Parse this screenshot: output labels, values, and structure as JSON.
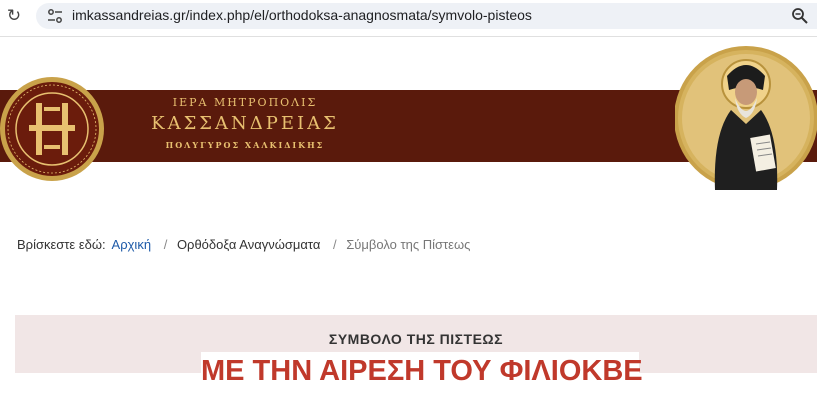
{
  "browser": {
    "url": "imkassandreias.gr/index.php/el/orthodoksa-anagnosmata/symvolo-pisteos",
    "reload_icon": "reload-icon",
    "site_info_icon": "tune-icon",
    "zoom_icon": "zoom-icon"
  },
  "header": {
    "line1": "ΙΕΡΑ ΜΗΤΡΟΠΟΛΙΣ",
    "line2": "ΚΑΣΣΑΝΔΡΕΙΑΣ",
    "line3": "ΠΟΛΥΓΥΡΟΣ ΧΑΛΚΙΔΙΚΗΣ",
    "colors": {
      "banner": "#5a1a0c",
      "gold": "#e8c070"
    }
  },
  "breadcrumb": {
    "prefix": "Βρίσκεστε εδώ:",
    "items": [
      "Αρχική",
      "Ορθόδοξα Αναγνώσματα",
      "Σύμβολο της Πίστεως"
    ],
    "separator": "/"
  },
  "article": {
    "kicker": "ΣΥΜΒΟΛΟ ΤΗΣ ΠΙΣΤΕΩΣ",
    "headline": "ΜΕ ΤΗΝ ΑΙΡΕΣΗ ΤΟΥ ΦΙΛΙΟΚΒΕ",
    "colors": {
      "headline": "#c0392b",
      "band": "#f1e6e6"
    }
  }
}
